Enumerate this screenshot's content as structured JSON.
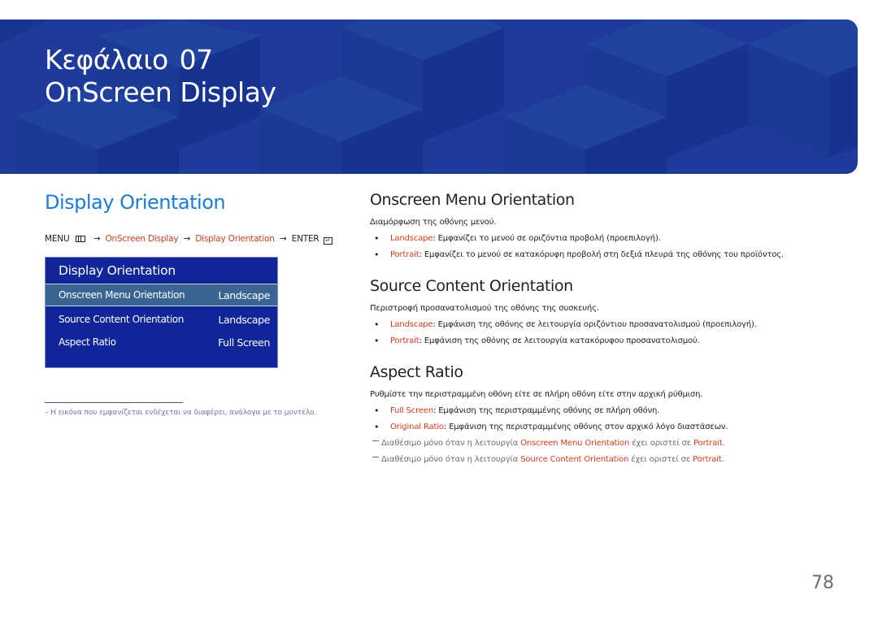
{
  "banner": {
    "chapter_label": "Κεφάλαιο",
    "chapter_number": "07",
    "title": "OnScreen Display",
    "color": "#1e3a9a"
  },
  "left": {
    "section_title": "Display Orientation",
    "menu_path": {
      "menu": "MENU",
      "menu_icon": "menu-grid-icon",
      "arrow": "→",
      "step1": "OnScreen Display",
      "step2": "Display Orientation",
      "enter": "ENTER",
      "enter_icon": "enter-icon"
    },
    "osd": {
      "header": "Display Orientation",
      "rows": [
        {
          "label": "Onscreen Menu Orientation",
          "value": "Landscape",
          "selected": true
        },
        {
          "label": "Source Content Orientation",
          "value": "Landscape",
          "selected": false
        },
        {
          "label": "Aspect Ratio",
          "value": "Full Screen",
          "selected": false
        }
      ]
    },
    "footnote": "–  Η εικόνα που εμφανίζεται ενδέχεται να διαφέρει, ανάλογα με το μοντέλο."
  },
  "right": {
    "sections": [
      {
        "title": "Onscreen Menu Orientation",
        "description": "Διαμόρφωση της οθόνης μενού.",
        "items": [
          {
            "term": "Landscape",
            "text": ": Εμφανίζει το μενού σε οριζόντια προβολή (προεπιλογή)."
          },
          {
            "term": "Portrait",
            "text": ": Εμφανίζει το μενού σε κατακόρυφη προβολή στη δεξιά πλευρά της οθόνης του προϊόντος."
          }
        ]
      },
      {
        "title": "Source Content Orientation",
        "description": "Περιστροφή προσανατολισμού της οθόνης της συσκευής.",
        "items": [
          {
            "term": "Landscape",
            "text": ": Εμφάνιση της οθόνης σε λειτουργία οριζόντιου προσανατολισμού (προεπιλογή)."
          },
          {
            "term": "Portrait",
            "text": ": Εμφάνιση της οθόνης σε λειτουργία κατακόρυφου προσανατολισμού."
          }
        ]
      },
      {
        "title": "Aspect Ratio",
        "description": "Ρυθμίστε την περιστραμμένη οθόνη είτε σε πλήρη οθόνη είτε στην αρχική ρύθμιση.",
        "items": [
          {
            "term": "Full Screen",
            "text": ": Εμφάνιση της περιστραμμένης οθόνης σε πλήρη οθόνη."
          },
          {
            "term": "Original Ratio",
            "text": ": Εμφάνιση της περιστραμμένης οθόνης στον αρχικό λόγο διαστάσεων."
          }
        ],
        "notes": [
          {
            "prefix": "Διαθέσιμο μόνο όταν η λειτουργία ",
            "term": "Onscreen Menu Orientation",
            "middle": " έχει οριστεί σε ",
            "value": "Portrait",
            "suffix": "."
          },
          {
            "prefix": "Διαθέσιμο μόνο όταν η λειτουργία ",
            "term": "Source Content Orientation",
            "middle": " έχει οριστεί σε ",
            "value": "Portrait",
            "suffix": "."
          }
        ]
      }
    ]
  },
  "page_number": "78",
  "colors": {
    "accent_blue": "#1c7bd6",
    "accent_red": "#d73b1e",
    "osd_bg": "#0f2599",
    "osd_selected": "#3a6593"
  }
}
